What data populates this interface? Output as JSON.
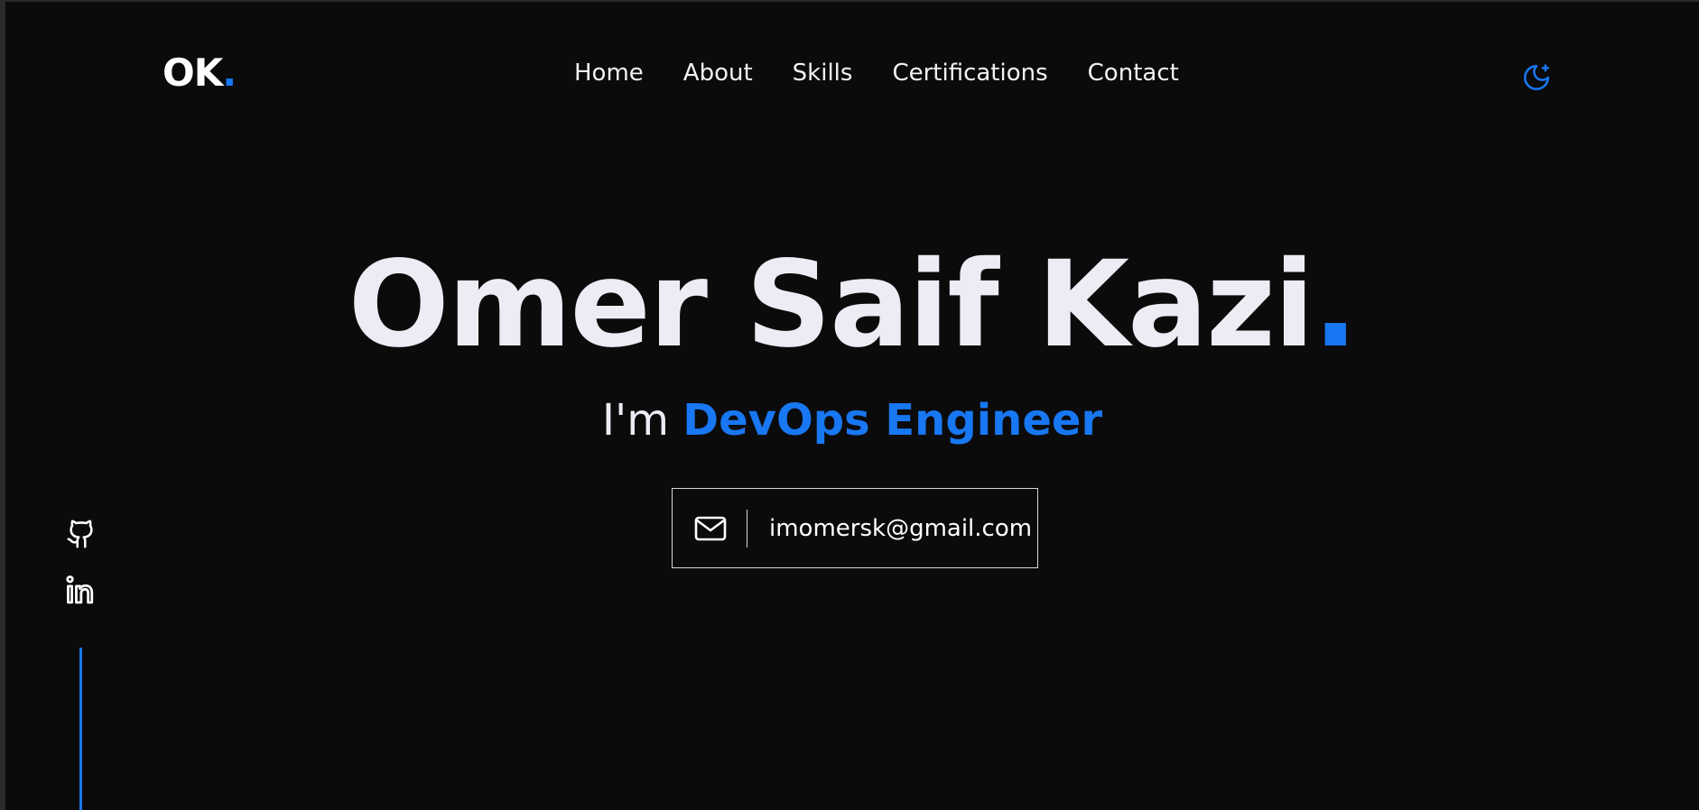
{
  "brand": {
    "logo_text": "OK",
    "logo_dot": "."
  },
  "nav": {
    "items": [
      {
        "label": "Home"
      },
      {
        "label": "About"
      },
      {
        "label": "Skills"
      },
      {
        "label": "Certifications"
      },
      {
        "label": "Contact"
      }
    ]
  },
  "header": {
    "theme_toggle_icon": "moon-icon"
  },
  "hero": {
    "name": "Omer Saif Kazi",
    "name_dot": ".",
    "prefix": "I'm",
    "role": "DevOps Engineer"
  },
  "contact": {
    "email": "imomersk@gmail.com",
    "email_icon": "mail-icon"
  },
  "social": {
    "icons": [
      "github-icon",
      "linkedin-icon"
    ]
  },
  "colors": {
    "background": "#0b0b0c",
    "accent": "#1877f2",
    "text": "#ececf4"
  }
}
